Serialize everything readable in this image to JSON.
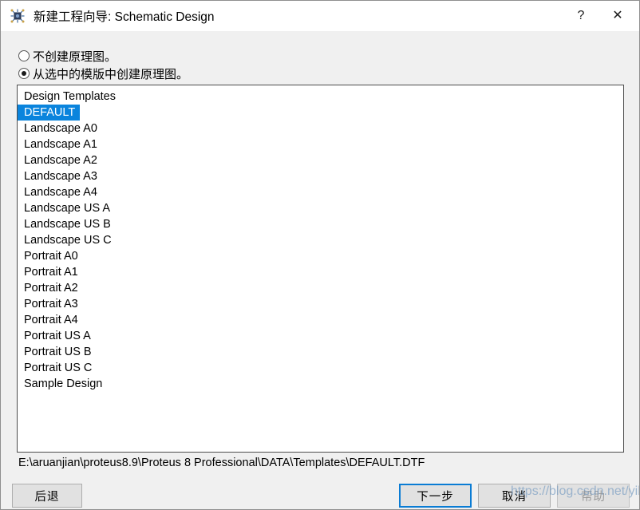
{
  "window": {
    "title": "新建工程向导: Schematic Design",
    "icon": "proteus-chip-icon",
    "accent_color": "#0a7cd4",
    "selection_color": "#0a84dd",
    "background_color": "#f0f0f0"
  },
  "caption": {
    "help_glyph": "?",
    "help_name": "help-button",
    "close_glyph": "✕",
    "close_name": "close-button"
  },
  "options": {
    "items": [
      {
        "label": "不创建原理图。",
        "checked": false
      },
      {
        "label": "从选中的模版中创建原理图。",
        "checked": true
      }
    ]
  },
  "templates": {
    "items": [
      {
        "label": "Design Templates",
        "selected": false
      },
      {
        "label": "DEFAULT",
        "selected": true
      },
      {
        "label": "Landscape A0",
        "selected": false
      },
      {
        "label": "Landscape A1",
        "selected": false
      },
      {
        "label": "Landscape A2",
        "selected": false
      },
      {
        "label": "Landscape A3",
        "selected": false
      },
      {
        "label": "Landscape A4",
        "selected": false
      },
      {
        "label": "Landscape US A",
        "selected": false
      },
      {
        "label": "Landscape US B",
        "selected": false
      },
      {
        "label": "Landscape US C",
        "selected": false
      },
      {
        "label": "Portrait A0",
        "selected": false
      },
      {
        "label": "Portrait A1",
        "selected": false
      },
      {
        "label": "Portrait A2",
        "selected": false
      },
      {
        "label": "Portrait A3",
        "selected": false
      },
      {
        "label": "Portrait A4",
        "selected": false
      },
      {
        "label": "Portrait US A",
        "selected": false
      },
      {
        "label": "Portrait US B",
        "selected": false
      },
      {
        "label": "Portrait US C",
        "selected": false
      },
      {
        "label": "Sample Design",
        "selected": false
      }
    ]
  },
  "path": {
    "value": "E:\\aruanjian\\proteus8.9\\Proteus 8 Professional\\DATA\\Templates\\DEFAULT.DTF"
  },
  "buttons": {
    "back": "后退",
    "next": "下一步",
    "cancel": "取消",
    "help": "帮助"
  },
  "watermark": {
    "text": "https://blog.csdn.net/yibohuixi"
  }
}
